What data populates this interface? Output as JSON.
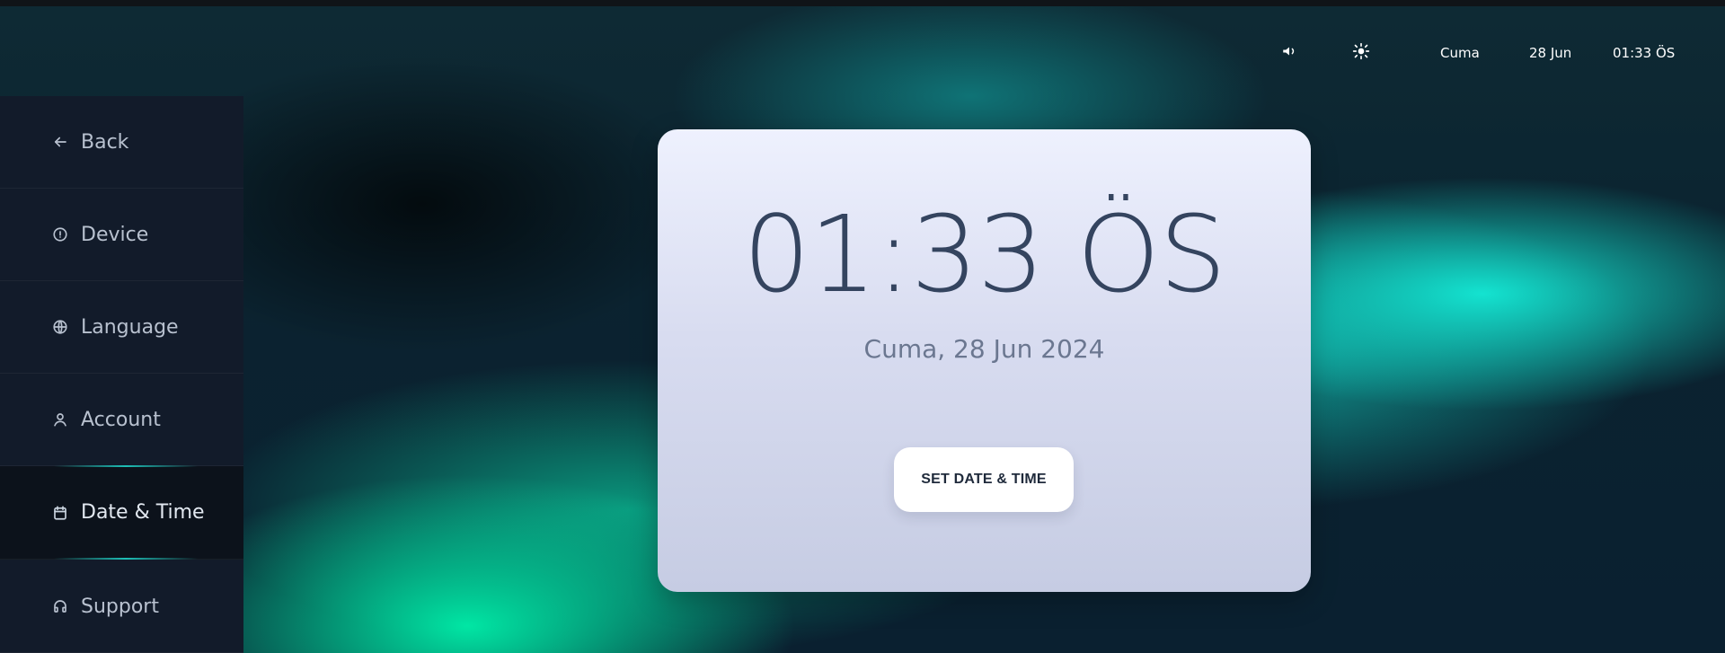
{
  "status_bar": {
    "volume_icon": "volume-icon",
    "brightness_icon": "brightness-icon",
    "day": "Cuma",
    "date": "28 Jun",
    "time": "01:33 ÖS"
  },
  "sidebar": {
    "items": [
      {
        "label": "Back",
        "icon": "arrow-left-icon"
      },
      {
        "label": "Device",
        "icon": "info-icon"
      },
      {
        "label": "Language",
        "icon": "globe-icon"
      },
      {
        "label": "Account",
        "icon": "user-icon"
      },
      {
        "label": "Date & Time",
        "icon": "calendar-icon",
        "active": true
      },
      {
        "label": "Support",
        "icon": "headphones-icon"
      }
    ]
  },
  "card": {
    "time": "01:33 ÖS",
    "date": "Cuma, 28 Jun 2024",
    "button_label": "SET DATE & TIME"
  },
  "colors": {
    "sidebar_bg": "#121b2a",
    "card_text": "#34445f",
    "accent": "#1ec8be"
  }
}
